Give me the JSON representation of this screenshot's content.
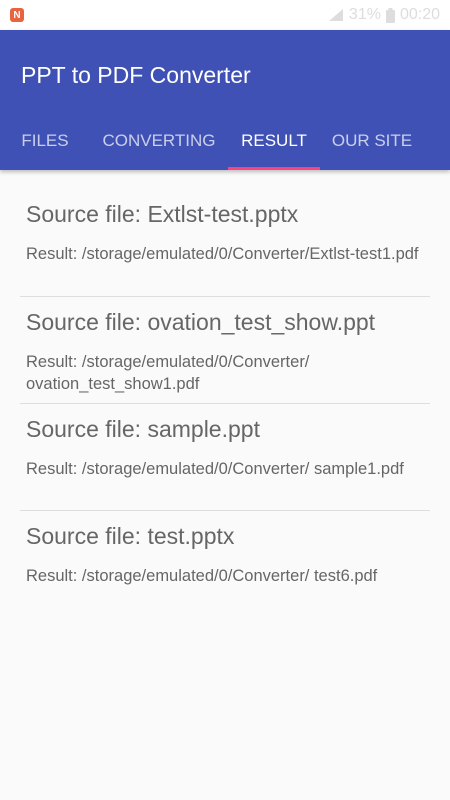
{
  "status_bar": {
    "app_icon": "converter-app-icon",
    "signal": "signal-icon",
    "battery_percent": "31%",
    "battery_icon": "battery-icon",
    "time": "00:20"
  },
  "app_bar": {
    "title": "PPT to PDF Converter",
    "background_color": "#3f51b5",
    "indicator_color": "#ff4081"
  },
  "tabs": [
    {
      "label": "FILES",
      "selected": false
    },
    {
      "label": "CONVERTING",
      "selected": false
    },
    {
      "label": "RESULT",
      "selected": true
    },
    {
      "label": "OUR SITE",
      "selected": false
    }
  ],
  "results": [
    {
      "source": "Source file: Extlst-test.pptx",
      "result": "Result: /storage/emulated/0/Converter/Extlst-test1.pdf"
    },
    {
      "source": "Source file: ovation_test_show.ppt",
      "result": "Result: /storage/emulated/0/Converter/ ovation_test_show1.pdf"
    },
    {
      "source": "Source file: sample.ppt",
      "result": "Result: /storage/emulated/0/Converter/ sample1.pdf"
    },
    {
      "source": "Source file: test.pptx",
      "result": "Result: /storage/emulated/0/Converter/ test6.pdf"
    }
  ]
}
